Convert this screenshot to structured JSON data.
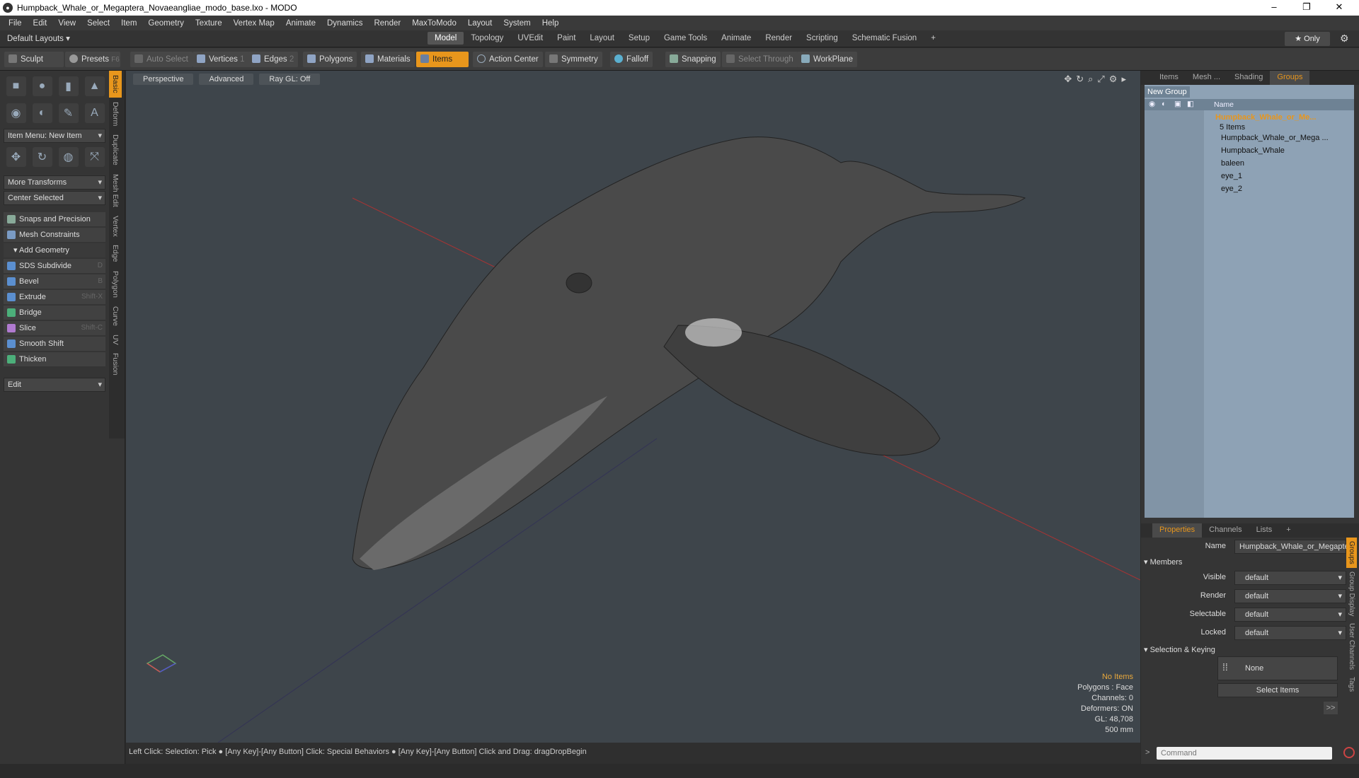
{
  "window": {
    "title": "Humpback_Whale_or_Megaptera_Novaeangliae_modo_base.lxo - MODO",
    "minimize": "–",
    "restore": "❐",
    "close": "✕"
  },
  "menu": [
    "File",
    "Edit",
    "View",
    "Select",
    "Item",
    "Geometry",
    "Texture",
    "Vertex Map",
    "Animate",
    "Dynamics",
    "Render",
    "MaxToModo",
    "Layout",
    "System",
    "Help"
  ],
  "layout": {
    "default_layouts": "Default Layouts ▾",
    "tabs": [
      "Model",
      "Topology",
      "UVEdit",
      "Paint",
      "Layout",
      "Setup",
      "Game Tools",
      "Animate",
      "Render",
      "Scripting",
      "Schematic Fusion",
      "+"
    ],
    "active_tab": "Model",
    "only": "★ Only"
  },
  "toolbar": {
    "sculpt": "Sculpt",
    "presets": "Presets",
    "presets_key": "F6",
    "auto_select": "Auto Select",
    "vertices": "Vertices",
    "vertices_n": "1",
    "edges": "Edges",
    "edges_n": "2",
    "polygons": "Polygons",
    "materials": "Materials",
    "items": "Items",
    "action_center": "Action Center",
    "symmetry": "Symmetry",
    "falloff": "Falloff",
    "snapping": "Snapping",
    "select_through": "Select Through",
    "workplane": "WorkPlane"
  },
  "left": {
    "item_menu": "Item Menu: New Item",
    "more_transforms": "More Transforms",
    "center_selected": "Center Selected",
    "snaps": "Snaps and Precision",
    "mesh_constraints": "Mesh Constraints",
    "add_geometry": "Add Geometry",
    "tools": [
      {
        "label": "SDS Subdivide",
        "key": "D",
        "color": "#5b8fd0"
      },
      {
        "label": "Bevel",
        "key": "B",
        "color": "#5b8fd0"
      },
      {
        "label": "Extrude",
        "key": "Shift-X",
        "color": "#5b8fd0"
      },
      {
        "label": "Bridge",
        "key": "",
        "color": "#4caf7a"
      },
      {
        "label": "Slice",
        "key": "Shift-C",
        "color": "#b07ad0"
      },
      {
        "label": "Smooth Shift",
        "key": "",
        "color": "#5b8fd0"
      },
      {
        "label": "Thicken",
        "key": "",
        "color": "#4caf7a"
      }
    ],
    "edit": "Edit",
    "vtabs": [
      "Basic",
      "Deform",
      "Duplicate",
      "Mesh Edit",
      "Vertex",
      "Edge",
      "Polygon",
      "Curve",
      "UV",
      "Fusion"
    ]
  },
  "viewport": {
    "perspective": "Perspective",
    "advanced": "Advanced",
    "raygl": "Ray GL: Off",
    "stats": {
      "no_items": "No Items",
      "polygons": "Polygons : Face",
      "channels": "Channels: 0",
      "deformers": "Deformers: ON",
      "gl": "GL: 48,708",
      "scale": "500 mm"
    }
  },
  "status": "Left Click: Selection: Pick ● [Any Key]-[Any Button] Click: Special Behaviors ● [Any Key]-[Any Button] Click and Drag: dragDropBegin",
  "groups": {
    "tabs": [
      "Items",
      "Mesh ...",
      "Shading",
      "Groups"
    ],
    "active": "Groups",
    "new_group": "New Group",
    "name_col": "Name",
    "root": "Humpback_Whale_or_Me...",
    "count": "5 Items",
    "children": [
      "Humpback_Whale_or_Mega ...",
      "Humpback_Whale",
      "baleen",
      "eye_1",
      "eye_2"
    ]
  },
  "properties": {
    "tabs": [
      "Properties",
      "Channels",
      "Lists",
      "+"
    ],
    "active": "Properties",
    "name_label": "Name",
    "name_value": "Humpback_Whale_or_Megaptera",
    "members": "Members",
    "visible_label": "Visible",
    "visible": "default",
    "render_label": "Render",
    "render": "default",
    "selectable_label": "Selectable",
    "selectable": "default",
    "locked_label": "Locked",
    "locked": "default",
    "selection_keying": "Selection & Keying",
    "none": "None",
    "select_items": "Select Items",
    "more": ">>",
    "vtabs": [
      "Groups",
      "Group Display",
      "User Channels",
      "Tags"
    ]
  },
  "command": {
    "placeholder": "Command"
  },
  "colors": {
    "accent": "#e8961c",
    "viewport": "#3e454b",
    "group_bg": "#8ea2b5"
  }
}
